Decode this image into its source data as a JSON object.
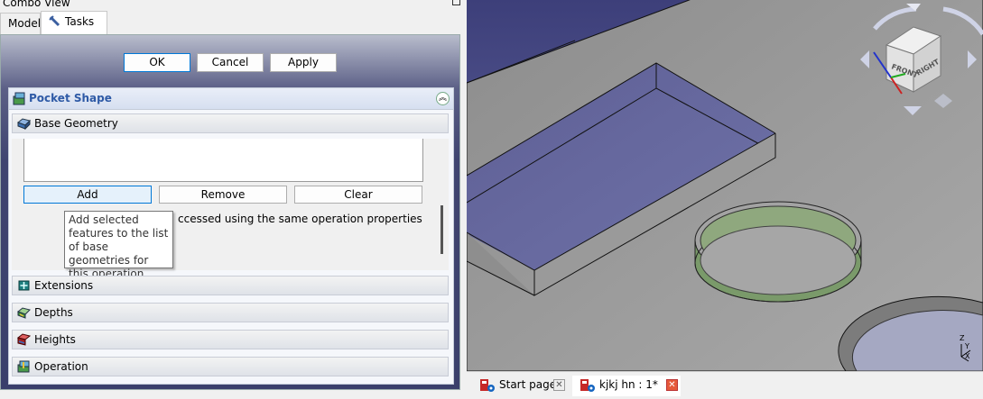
{
  "combo": {
    "title": "Combo View",
    "tabs": [
      {
        "label": "Model"
      },
      {
        "label": "Tasks"
      }
    ]
  },
  "dialog_buttons": {
    "ok": "OK",
    "cancel": "Cancel",
    "apply": "Apply"
  },
  "task_box": {
    "title": "Pocket Shape",
    "sections": {
      "base_geometry": "Base Geometry",
      "extensions": "Extensions",
      "depths": "Depths",
      "heights": "Heights",
      "operation": "Operation"
    },
    "buttons": {
      "add": "Add",
      "remove": "Remove",
      "clear": "Clear"
    },
    "info_text": "ccessed using the same operation properties",
    "tooltip": "Add selected features to the list of base geometries for this operation."
  },
  "nav_cube": {
    "front": "FRONT",
    "right": "RIGHT",
    "axes": [
      "Z",
      "Y",
      "X"
    ]
  },
  "doc_tabs": [
    {
      "label": "Start page"
    },
    {
      "label": "kjkj hn : 1*"
    }
  ],
  "colors": {
    "viewport_bg": "#4a4c86",
    "task_title": "#2e5aa6",
    "close_red": "#e65a3b"
  }
}
